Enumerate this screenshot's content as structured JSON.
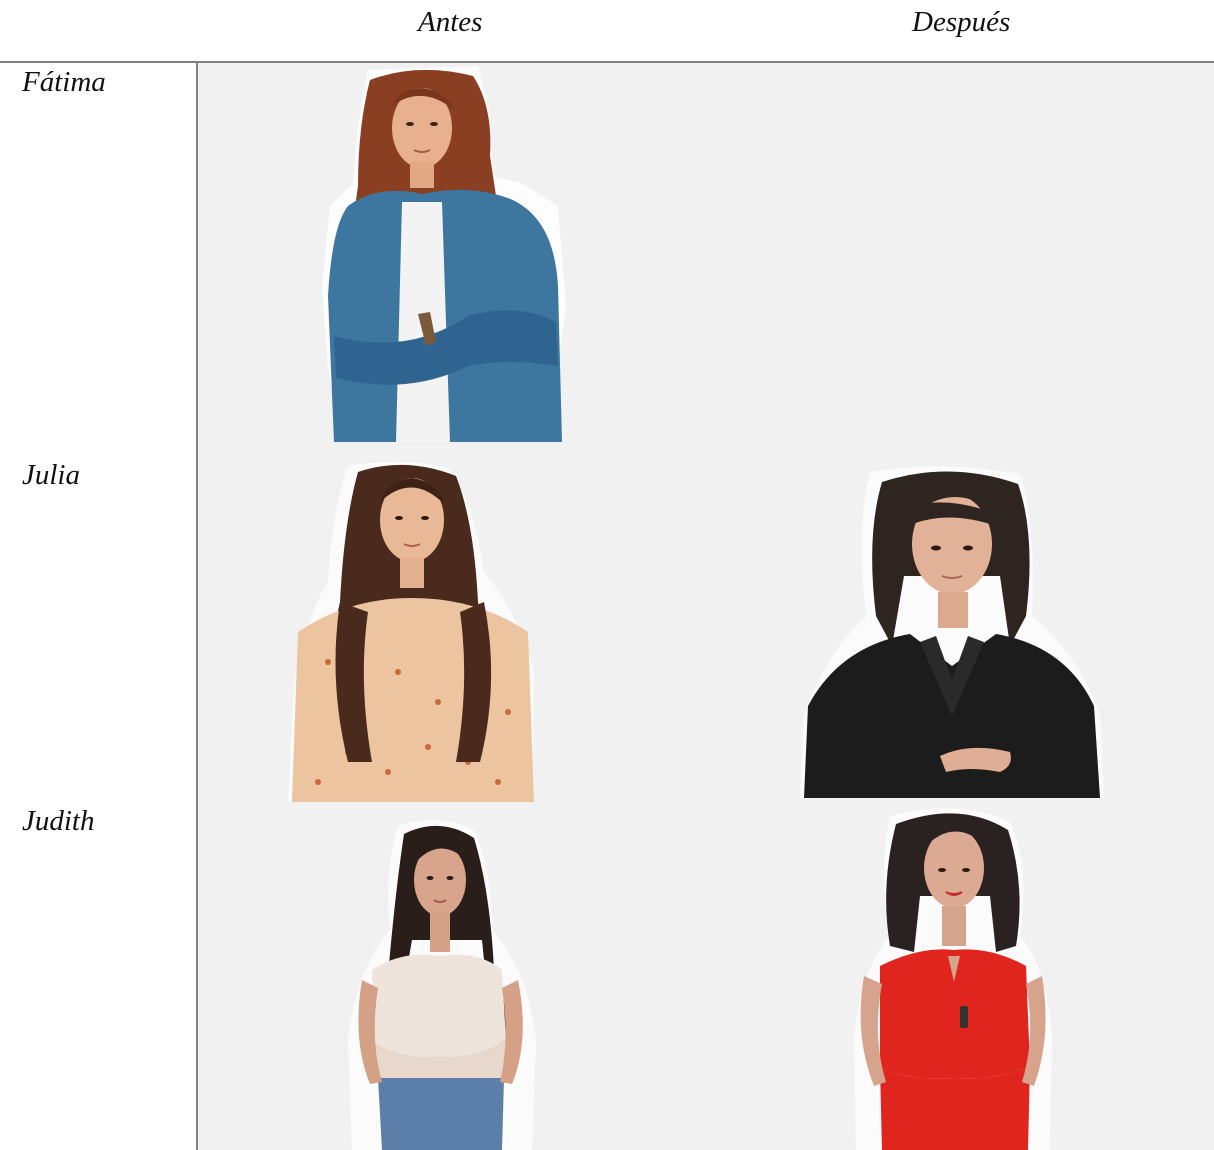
{
  "columns": {
    "before": "Antes",
    "after": "Después"
  },
  "rows": [
    {
      "name": "Fátima",
      "before_photo": "woman-denim-shirt-arms-crossed-photo",
      "after_photo": ""
    },
    {
      "name": "Julia",
      "before_photo": "woman-floral-blouse-long-curly-hair-photo",
      "after_photo": "woman-black-blazer-photo"
    },
    {
      "name": "Judith",
      "before_photo": "woman-white-camisole-photo",
      "after_photo": "woman-red-halter-top-photo"
    }
  ]
}
